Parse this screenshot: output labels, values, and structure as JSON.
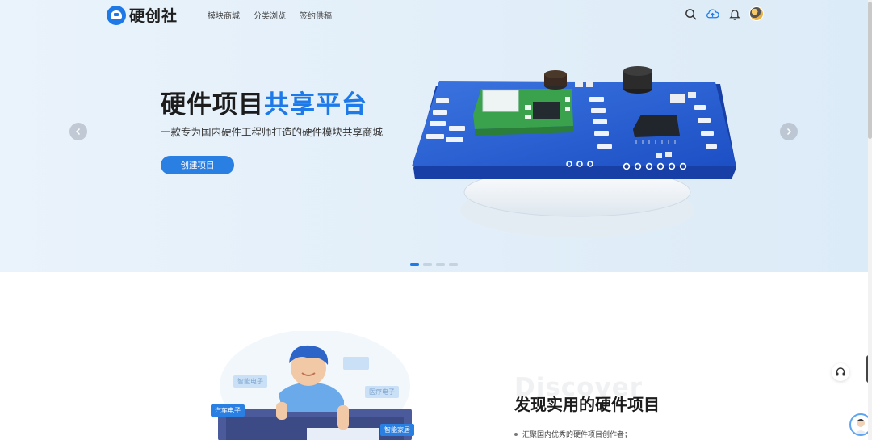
{
  "brand": {
    "name": "硬创社",
    "accent": "#1e7ae8"
  },
  "nav": {
    "menu": [
      "模块商城",
      "分类浏览",
      "签约供稿"
    ],
    "icons": [
      "search-icon",
      "cloud-upload-icon",
      "bell-icon",
      "avatar"
    ]
  },
  "hero": {
    "title_part1": "硬件项目",
    "title_part2": "共享平台",
    "subtitle": "一款专为国内硬件工程师打造的硬件模块共享商城",
    "button": "创建项目",
    "slides": 4,
    "active_slide": 1
  },
  "section": {
    "bg_word": "Discover",
    "title": "发现实用的硬件项目",
    "bullets": [
      "汇聚国内优秀的硬件项目创作者；"
    ],
    "tags": {
      "car": "汽车电子",
      "home": "智能家居",
      "ghost1": "智能电子",
      "ghost2": "",
      "ghost3": "医疗电子"
    }
  }
}
